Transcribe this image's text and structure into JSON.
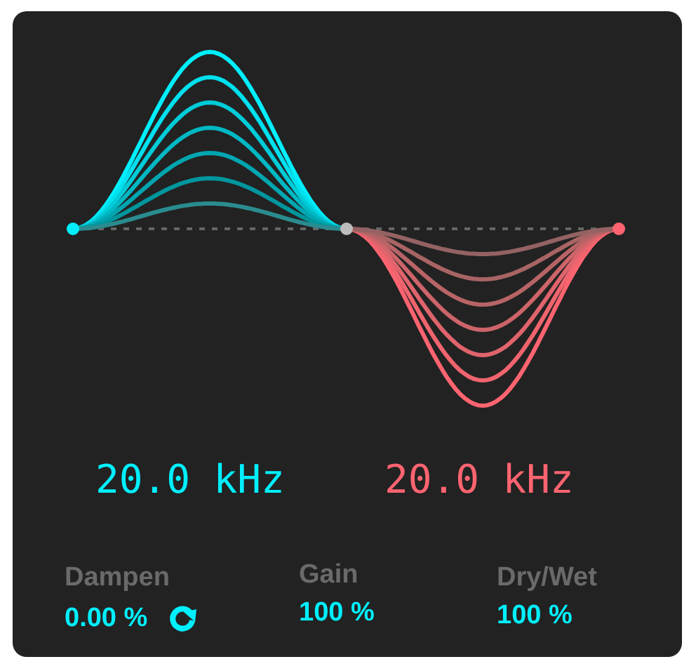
{
  "frequencies": [
    {
      "text": "20.0 kHz",
      "color": "#00f0ff"
    },
    {
      "text": "20.0 kHz",
      "color": "#ff6470"
    }
  ],
  "params": [
    {
      "label": "Dampen",
      "value": "0.00 %",
      "kind": "reset"
    },
    {
      "label": "Gain",
      "value": "100 %",
      "kind": "plain"
    },
    {
      "label": "Dry/Wet",
      "value": "100 %",
      "kind": "plain"
    }
  ]
}
